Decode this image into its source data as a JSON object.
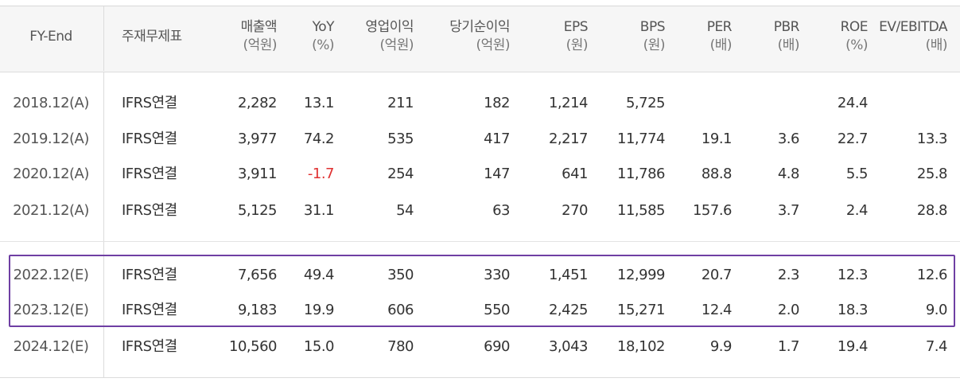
{
  "table": {
    "headers": [
      {
        "key": "fy",
        "l1": "FY-End",
        "l2": ""
      },
      {
        "key": "acct",
        "l1": "주재무제표",
        "l2": ""
      },
      {
        "key": "sales",
        "l1": "매출액",
        "l2": "(억원)"
      },
      {
        "key": "yoy",
        "l1": "YoY",
        "l2": "(%)"
      },
      {
        "key": "op",
        "l1": "영업이익",
        "l2": "(억원)"
      },
      {
        "key": "net",
        "l1": "당기순이익",
        "l2": "(억원)"
      },
      {
        "key": "eps",
        "l1": "EPS",
        "l2": "(원)"
      },
      {
        "key": "bps",
        "l1": "BPS",
        "l2": "(원)"
      },
      {
        "key": "per",
        "l1": "PER",
        "l2": "(배)"
      },
      {
        "key": "pbr",
        "l1": "PBR",
        "l2": "(배)"
      },
      {
        "key": "roe",
        "l1": "ROE",
        "l2": "(%)"
      },
      {
        "key": "ev",
        "l1": "EV/EBITDA",
        "l2": "(배)"
      }
    ],
    "rows": [
      [
        "2018.12(A)",
        "IFRS연결",
        "2,282",
        "13.1",
        "211",
        "182",
        "1,214",
        "5,725",
        "",
        "",
        "24.4",
        ""
      ],
      [
        "2019.12(A)",
        "IFRS연결",
        "3,977",
        "74.2",
        "535",
        "417",
        "2,217",
        "11,774",
        "19.1",
        "3.6",
        "22.7",
        "13.3"
      ],
      [
        "2020.12(A)",
        "IFRS연결",
        "3,911",
        "-1.7",
        "254",
        "147",
        "641",
        "11,786",
        "88.8",
        "4.8",
        "5.5",
        "25.8"
      ],
      [
        "2021.12(A)",
        "IFRS연결",
        "5,125",
        "31.1",
        "54",
        "63",
        "270",
        "11,585",
        "157.6",
        "3.7",
        "2.4",
        "28.8"
      ],
      [
        "2022.12(E)",
        "IFRS연결",
        "7,656",
        "49.4",
        "350",
        "330",
        "1,451",
        "12,999",
        "20.7",
        "2.3",
        "12.3",
        "12.6"
      ],
      [
        "2023.12(E)",
        "IFRS연결",
        "9,183",
        "19.9",
        "606",
        "550",
        "2,425",
        "15,271",
        "12.4",
        "2.0",
        "18.3",
        "9.0"
      ],
      [
        "2024.12(E)",
        "IFRS연결",
        "10,560",
        "15.0",
        "780",
        "690",
        "3,043",
        "18,102",
        "9.9",
        "1.7",
        "19.4",
        "7.4"
      ]
    ],
    "negative_color": "#e03131",
    "highlight_color": "#6f3fa3"
  }
}
